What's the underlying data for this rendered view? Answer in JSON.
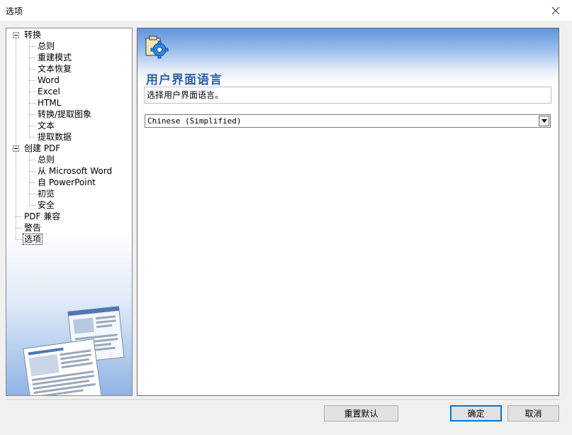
{
  "window": {
    "title": "选项"
  },
  "tree": {
    "items": [
      {
        "label": "转换",
        "level": 0,
        "expander": true
      },
      {
        "label": "总则",
        "level": 1
      },
      {
        "label": "重建模式",
        "level": 1
      },
      {
        "label": "文本恢复",
        "level": 1
      },
      {
        "label": "Word",
        "level": 1
      },
      {
        "label": "Excel",
        "level": 1
      },
      {
        "label": "HTML",
        "level": 1
      },
      {
        "label": "转换/提取图象",
        "level": 1
      },
      {
        "label": "文本",
        "level": 1
      },
      {
        "label": "提取数据",
        "level": 1
      },
      {
        "label": "创建 PDF",
        "level": 0,
        "expander": true
      },
      {
        "label": "总则",
        "level": 1
      },
      {
        "label": "从 Microsoft Word",
        "level": 1
      },
      {
        "label": "自 PowerPoint",
        "level": 1
      },
      {
        "label": "初览",
        "level": 1
      },
      {
        "label": "安全",
        "level": 1
      },
      {
        "label": "PDF 兼容",
        "level": 0
      },
      {
        "label": "警告",
        "level": 0
      },
      {
        "label": "选项",
        "level": 0,
        "selected": true
      }
    ]
  },
  "content": {
    "title": "用户界面语言",
    "description": "选择用户界面语言。",
    "language_selected": "Chinese (Simplified)"
  },
  "buttons": {
    "reset": "重置默认",
    "ok": "确定",
    "cancel": "取消"
  },
  "colors": {
    "accent": "#0078d7",
    "title_text": "#2f5fa8",
    "header_gradient_top": "#5f94dc"
  },
  "icons": {
    "close": "close-icon",
    "settings": "gear-clipboard-icon",
    "dropdown": "chevron-down-icon"
  }
}
